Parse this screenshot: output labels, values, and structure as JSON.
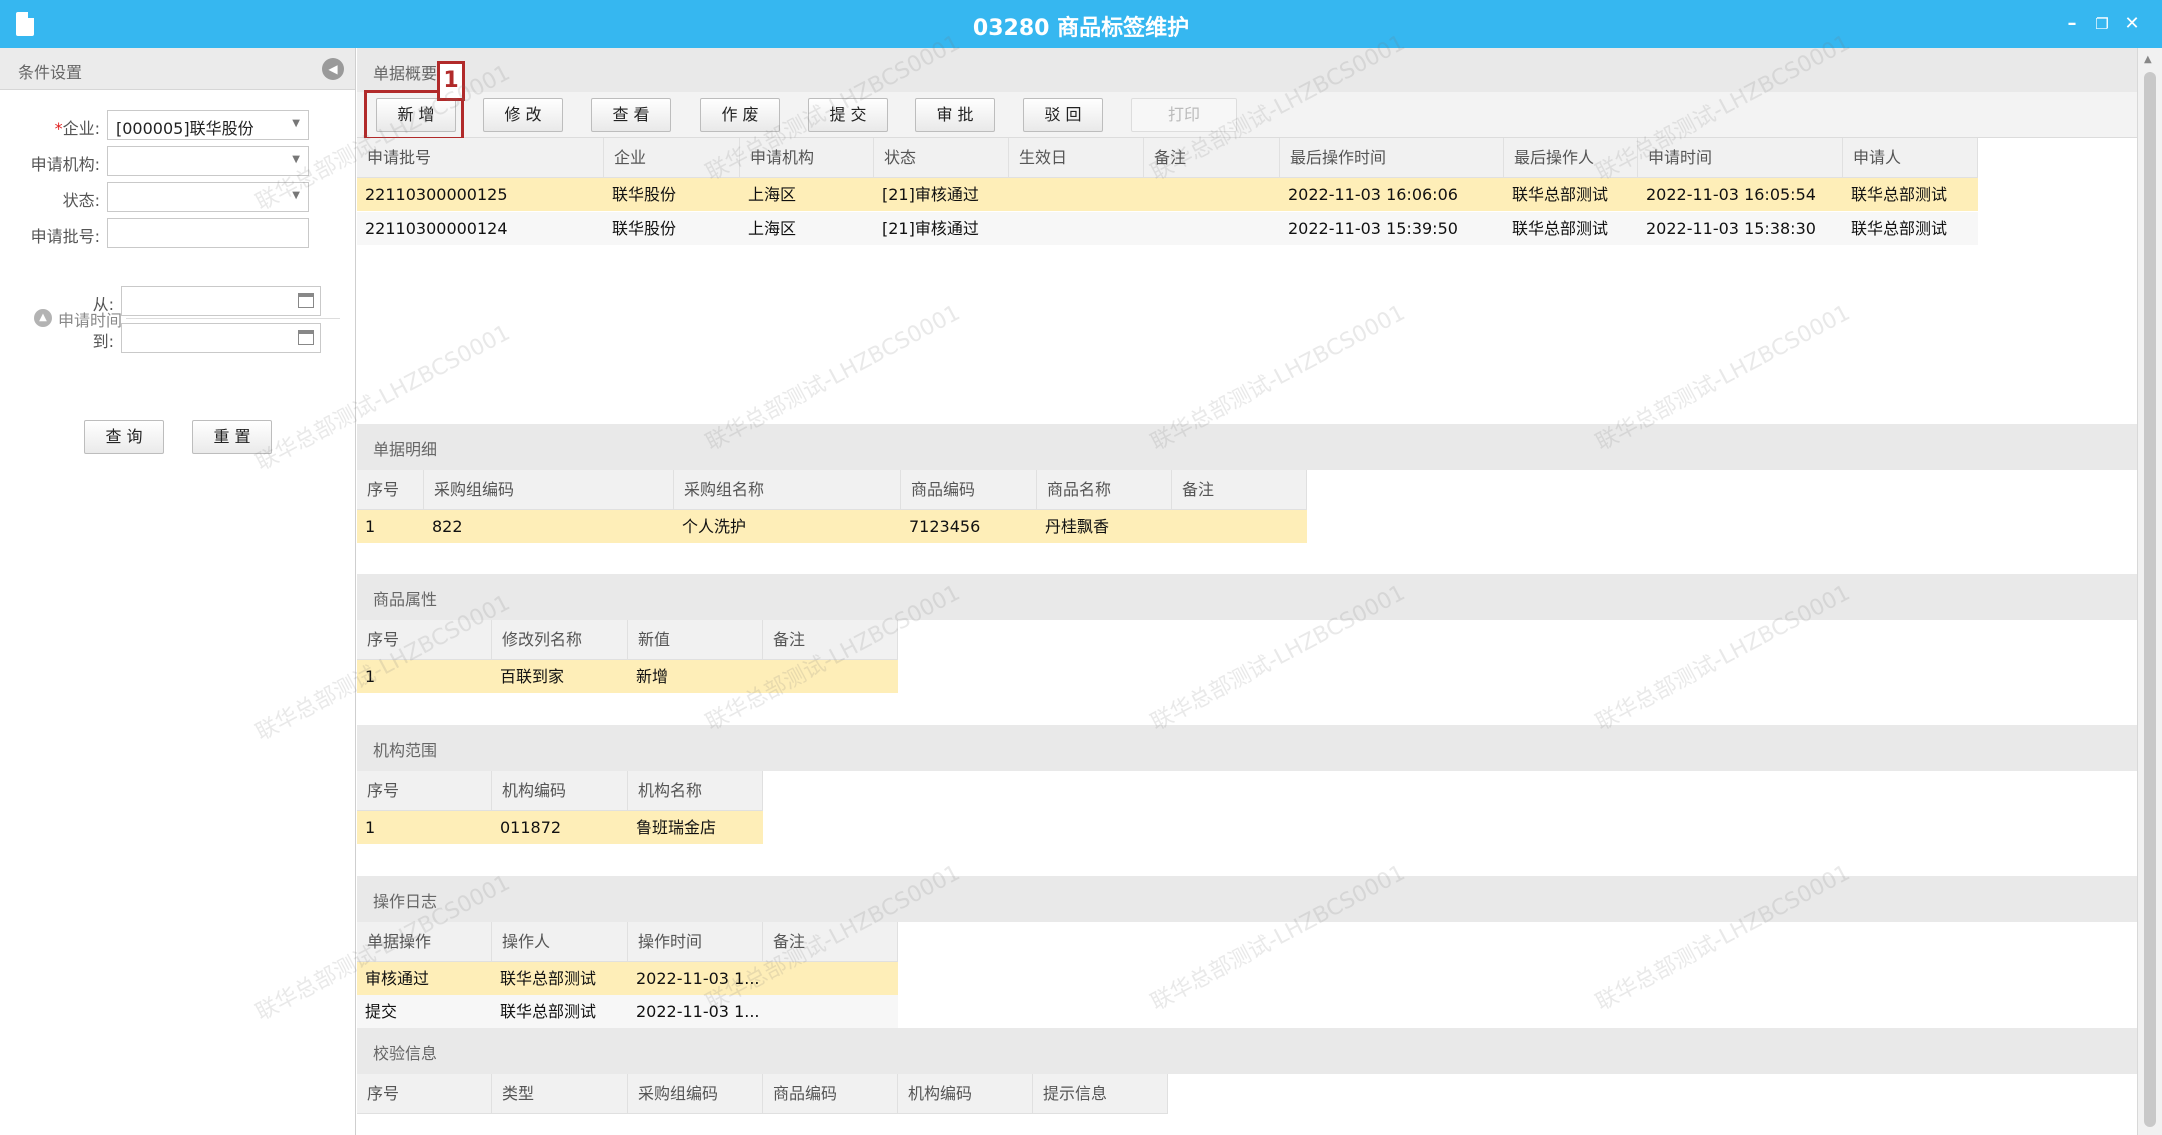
{
  "window": {
    "title": "03280 商品标签维护",
    "controls": {
      "minimize": "–",
      "restore": "❐",
      "close": "✕"
    }
  },
  "sidebar": {
    "title": "条件设置",
    "fields": {
      "company": {
        "label": "企业:",
        "required_mark": "*",
        "value": "[000005]联华股份"
      },
      "org": {
        "label": "申请机构:",
        "value": ""
      },
      "status": {
        "label": "状态:",
        "value": ""
      },
      "batch_no": {
        "label": "申请批号:",
        "value": ""
      }
    },
    "time_group": {
      "title": "申请时间",
      "from_label": "从:",
      "from_value": "",
      "to_label": "到:",
      "to_value": ""
    },
    "buttons": {
      "query": "查 询",
      "reset": "重 置"
    }
  },
  "summary": {
    "title": "单据概要",
    "toolbar": {
      "add": "新 增",
      "edit": "修 改",
      "view": "查 看",
      "void": "作 废",
      "submit": "提 交",
      "approve": "审 批",
      "reject": "驳 回",
      "print": "打印"
    },
    "annotation_number": "1",
    "columns": [
      "申请批号",
      "企业",
      "申请机构",
      "状态",
      "生效日",
      "备注",
      "最后操作时间",
      "最后操作人",
      "申请时间",
      "申请人"
    ],
    "rows": [
      [
        "22110300000125",
        "联华股份",
        "上海区",
        "[21]审核通过",
        "",
        "",
        "2022-11-03 16:06:06",
        "联华总部测试",
        "2022-11-03 16:05:54",
        "联华总部测试"
      ],
      [
        "22110300000124",
        "联华股份",
        "上海区",
        "[21]审核通过",
        "",
        "",
        "2022-11-03 15:39:50",
        "联华总部测试",
        "2022-11-03 15:38:30",
        "联华总部测试"
      ]
    ]
  },
  "detail": {
    "title": "单据明细",
    "columns": [
      "序号",
      "采购组编码",
      "采购组名称",
      "商品编码",
      "商品名称",
      "备注"
    ],
    "rows": [
      [
        "1",
        "822",
        "个人洗护",
        "7123456",
        "丹桂飘香",
        ""
      ]
    ]
  },
  "attributes": {
    "title": "商品属性",
    "columns": [
      "序号",
      "修改列名称",
      "新值",
      "备注"
    ],
    "rows": [
      [
        "1",
        "百联到家",
        "新增",
        ""
      ]
    ]
  },
  "org_scope": {
    "title": "机构范围",
    "columns": [
      "序号",
      "机构编码",
      "机构名称"
    ],
    "rows": [
      [
        "1",
        "011872",
        "鲁班瑞金店"
      ]
    ]
  },
  "log": {
    "title": "操作日志",
    "columns": [
      "单据操作",
      "操作人",
      "操作时间",
      "备注"
    ],
    "rows": [
      [
        "审核通过",
        "联华总部测试",
        "2022-11-03 1...",
        ""
      ],
      [
        "提交",
        "联华总部测试",
        "2022-11-03 1...",
        ""
      ]
    ]
  },
  "validation": {
    "title": "校验信息",
    "columns": [
      "序号",
      "类型",
      "采购组编码",
      "商品编码",
      "机构编码",
      "提示信息"
    ]
  },
  "watermark_text": "联华总部测试-LHZBCS0001",
  "colors": {
    "titlebar": "#36b7f0",
    "selected_row": "#feeeb8",
    "annotation": "#b12a2a"
  }
}
